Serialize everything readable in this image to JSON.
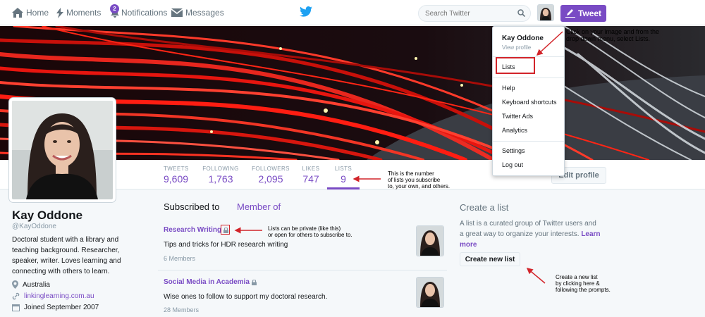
{
  "colors": {
    "accent": "#794bc4",
    "annotation": "#d2242a",
    "twitter_blue": "#1da1f2"
  },
  "nav": {
    "home": "Home",
    "moments": "Moments",
    "notifications": "Notifications",
    "notifications_badge": "2",
    "messages": "Messages",
    "search_placeholder": "Search Twitter",
    "tweet": "Tweet"
  },
  "profile": {
    "name": "Kay Oddone",
    "handle": "@KayOddone",
    "bio": "Doctoral student with a library and teaching background. Researcher, speaker, writer. Loves learning and connecting with others to learn.",
    "location": "Australia",
    "website": "linkinglearning.com.au",
    "joined": "Joined September 2007"
  },
  "stats": [
    {
      "label": "TWEETS",
      "value": "9,609"
    },
    {
      "label": "FOLLOWING",
      "value": "1,763"
    },
    {
      "label": "FOLLOWERS",
      "value": "2,095"
    },
    {
      "label": "LIKES",
      "value": "747"
    },
    {
      "label": "LISTS",
      "value": "9"
    }
  ],
  "edit_profile": "Edit profile",
  "tabs": {
    "subscribed": "Subscribed to",
    "member": "Member of"
  },
  "lists": [
    {
      "title": "Research Writing",
      "description": "Tips and tricks for HDR research writing",
      "members": "6 Members"
    },
    {
      "title": "Social Media in Academia",
      "description": "Wise ones to follow to support my doctoral research.",
      "members": "28 Members"
    }
  ],
  "create_list": {
    "title": "Create a list",
    "text": "A list is a curated group of Twitter users and a great way to organize your interests.",
    "learn_more": "Learn more",
    "button": "Create new list"
  },
  "dropdown": {
    "name": "Kay Oddone",
    "view_profile": "View profile",
    "lists": "Lists",
    "help": "Help",
    "keyboard": "Keyboard shortcuts",
    "ads": "Twitter Ads",
    "analytics": "Analytics",
    "settings": "Settings",
    "logout": "Log out"
  },
  "annotations": {
    "dropdown_line1": "Click on your image and from the",
    "dropdown_line2": "drop down menu, select Lists.",
    "lists_line1": "This is the number",
    "lists_line2": "of lists you subscribe",
    "lists_line3": "to, your own, and others.",
    "private_line1": "Lists can be private (like this)",
    "private_line2": "or open for others to subscribe to.",
    "create_line1": "Create a new list",
    "create_line2": "by clicking here &",
    "create_line3": "following the prompts."
  }
}
